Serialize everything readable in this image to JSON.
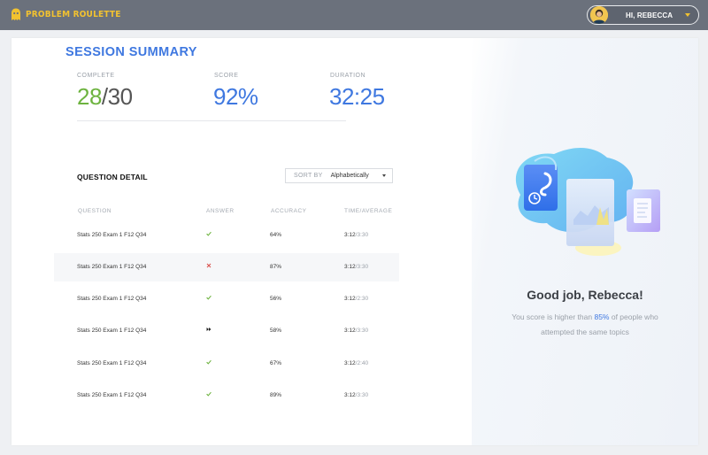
{
  "app": {
    "name": "PROBLEM ROULETTE",
    "greeting": "HI, REBECCA"
  },
  "summary": {
    "title": "SESSION SUMMARY",
    "complete_label": "COMPLETE",
    "complete_done": "28",
    "complete_total": "/30",
    "score_label": "SCORE",
    "score_value": "92%",
    "duration_label": "DURATION",
    "duration_value": "32:25"
  },
  "detail": {
    "title": "QUESTION DETAIL",
    "sort_label": "SORT BY",
    "sort_value": "Alphabetically",
    "columns": [
      "QUESTION",
      "ANSWER",
      "ACCURACY",
      "TIME/AVERAGE"
    ],
    "rows": [
      {
        "question": "Stats  250 Exam 1 F12 Q34",
        "answer": "correct",
        "accuracy": "64%",
        "time": "3:12",
        "average": "/3:30"
      },
      {
        "question": "Stats  250 Exam 1 F12 Q34",
        "answer": "incorrect",
        "accuracy": "87%",
        "time": "3:12",
        "average": "/3:30"
      },
      {
        "question": "Stats  250 Exam 1 F12 Q34",
        "answer": "correct",
        "accuracy": "56%",
        "time": "3:12",
        "average": "/2:30"
      },
      {
        "question": "Stats  250 Exam 1 F12 Q34",
        "answer": "skipped",
        "accuracy": "58%",
        "time": "3:12",
        "average": "/3:30"
      },
      {
        "question": "Stats  250 Exam 1 F12 Q34",
        "answer": "correct",
        "accuracy": "67%",
        "time": "3:12",
        "average": "/2:40"
      },
      {
        "question": "Stats  250 Exam 1 F12 Q34",
        "answer": "correct",
        "accuracy": "89%",
        "time": "3:12",
        "average": "/3:30"
      }
    ]
  },
  "result": {
    "headline": "Good job, Rebecca!",
    "message_prefix": "You score is higher than ",
    "percentile": "85%",
    "message_suffix": " of people who attempted the same topics"
  },
  "colors": {
    "topbar": "#6b717c",
    "brand_yellow": "#f2c230",
    "accent_blue": "#3f78e0",
    "correct_green": "#6db33f",
    "incorrect_red": "#d9534f"
  }
}
